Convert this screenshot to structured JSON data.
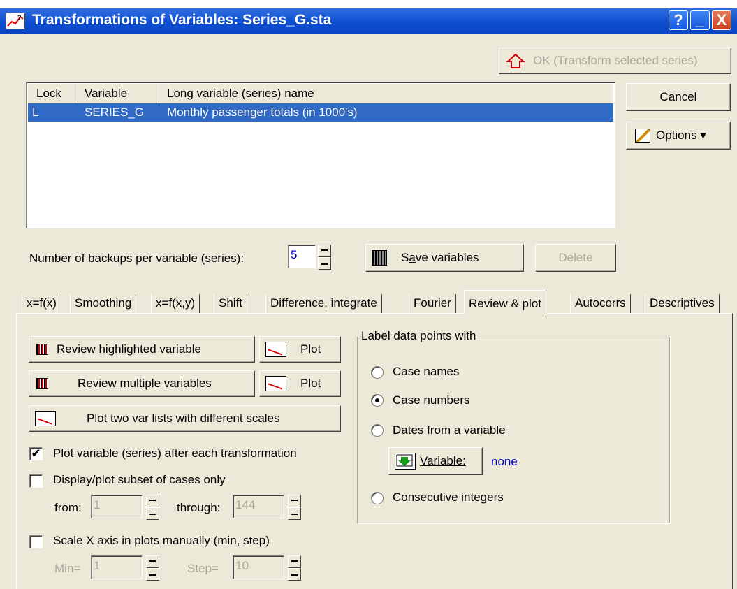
{
  "window": {
    "title": "Transformations of Variables: Series_G.sta",
    "help": "?",
    "minimize": "_",
    "close": "X"
  },
  "buttons": {
    "ok": "OK (Transform selected series)",
    "cancel": "Cancel",
    "options": "Options ▾",
    "save_pre": "S",
    "save_u": "a",
    "save_post": "ve variables",
    "delete": "Delete"
  },
  "list": {
    "headers": [
      "Lock",
      "Variable",
      "Long variable (series) name"
    ],
    "rows": [
      {
        "lock": "L",
        "variable": "SERIES_G",
        "name": "Monthly passenger totals (in 1000's)"
      }
    ]
  },
  "backups": {
    "label": "Number of backups per variable (series):",
    "value": "5"
  },
  "tabs": [
    "x=f(x)",
    "Smoothing",
    "x=f(x,y)",
    "Shift",
    "Difference, integrate",
    "Fourier",
    "Review & plot",
    "Autocorrs",
    "Descriptives"
  ],
  "active_tab": "Review & plot",
  "review": {
    "highlighted": "Review highlighted variable",
    "multiple": "Review multiple variables",
    "plot1": "Plot",
    "plot2": "Plot",
    "two_lists": "Plot two var lists with different scales",
    "plot_after": "Plot variable (series) after each transformation",
    "plot_after_checked": true,
    "subset": "Display/plot subset of cases only",
    "subset_checked": false,
    "from_label": "from:",
    "from_value": "1",
    "through_label": "through:",
    "through_value": "144",
    "scale_x": "Scale X axis in plots manually (min, step)",
    "scale_checked": false,
    "min_label": "Min=",
    "min_value": "1",
    "step_label": "Step=",
    "step_value": "10"
  },
  "label_points": {
    "group": "Label data points with",
    "options": [
      "Case names",
      "Case numbers",
      "Dates from a variable",
      "Consecutive integers"
    ],
    "selected": "Case numbers",
    "variable_button": "Variable:",
    "variable_value": "none"
  }
}
